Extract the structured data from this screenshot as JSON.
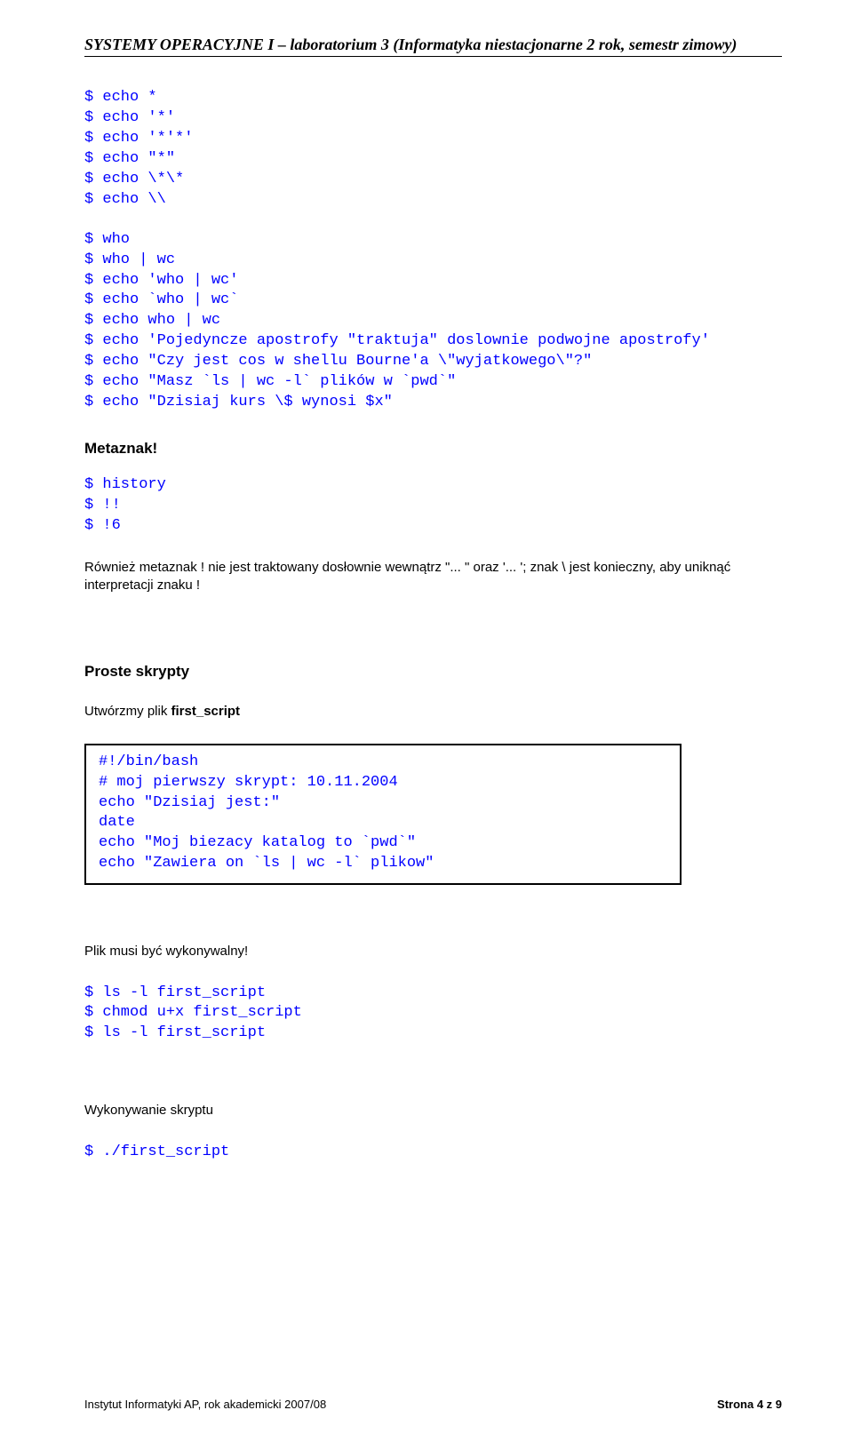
{
  "header": "SYSTEMY OPERACYJNE I – laboratorium 3 (Informatyka niestacjonarne 2 rok,  semestr zimowy)",
  "block1": "$ echo *\n$ echo '*'\n$ echo '*'*'\n$ echo \"*\"\n$ echo \\*\\*\n$ echo \\\\",
  "block2": "$ who\n$ who | wc\n$ echo 'who | wc'\n$ echo `who | wc`\n$ echo who | wc\n$ echo 'Pojedyncze apostrofy \"traktuja\" doslownie podwojne apostrofy'\n$ echo \"Czy jest cos w shellu Bourne'a \\\"wyjatkowego\\\"?\"\n$ echo \"Masz `ls | wc -l` plików w `pwd`\"\n$ echo \"Dzisiaj kurs \\$ wynosi $x\"",
  "meta_head": "Metaznak!",
  "block3": "$ history\n$ !!\n$ !6",
  "para1_a": "Również metaznak ! nie jest traktowany dosłownie wewnątrz \"... \" oraz '... '; znak \\ jest konieczny, aby uniknąć interpretacji znaku !",
  "scripts_head": "Proste skrypty",
  "create_a": "Utwórzmy plik ",
  "create_b": "first_script",
  "codebox": "#!/bin/bash\n# moj pierwszy skrypt: 10.11.2004\necho \"Dzisiaj jest:\"\ndate\necho \"Moj biezacy katalog to `pwd`\"\necho \"Zawiera on `ls | wc -l` plikow\"",
  "exec_head": "Plik musi być wykonywalny!",
  "block4": "$ ls -l first_script\n$ chmod u+x first_script\n$ ls -l first_script",
  "run_head": "Wykonywanie skryptu",
  "block5": "$ ./first_script",
  "footer_left": "Instytut Informatyki AP, rok akademicki 2007/08",
  "footer_right": "Strona 4 z 9"
}
